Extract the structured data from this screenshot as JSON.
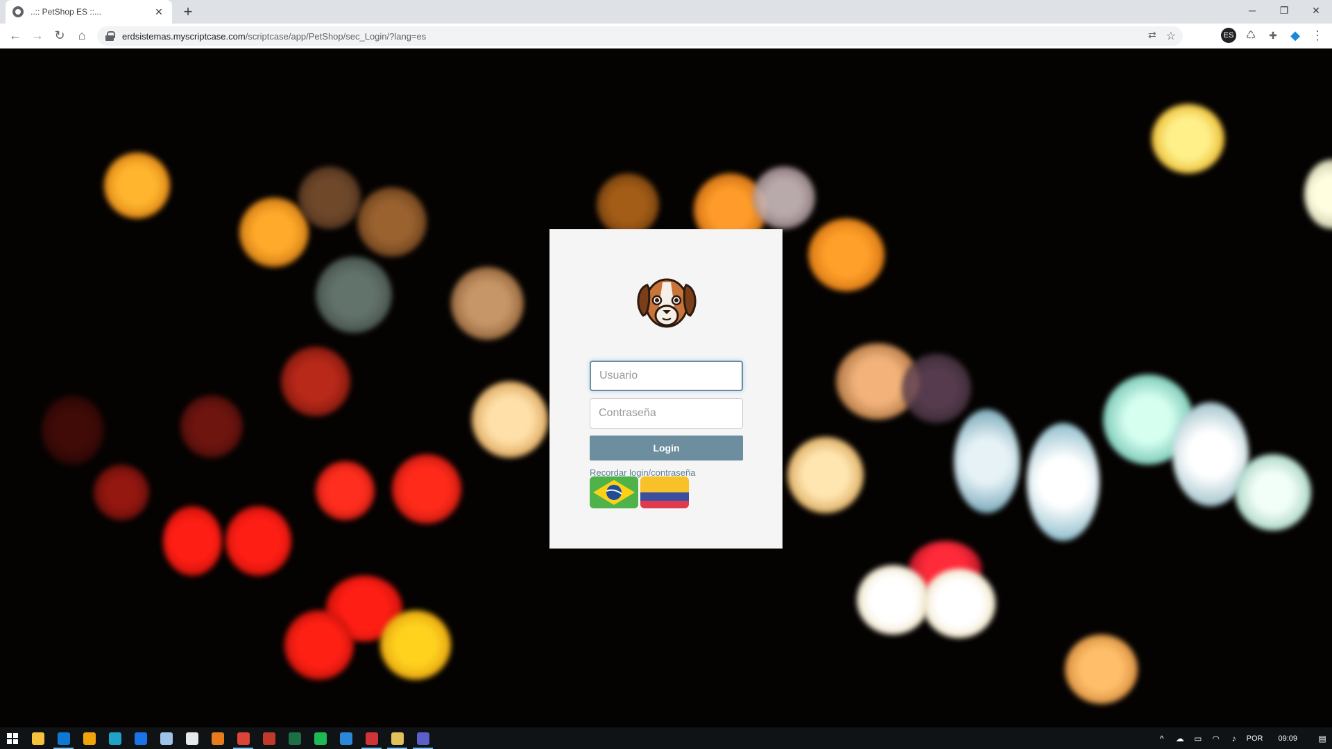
{
  "browser": {
    "tab_title": "..:: PetShop ES ::...",
    "tab_close": "✕",
    "new_tab": "+",
    "url_host": "erdsistemas.myscriptcase.com",
    "url_path": "/scriptcase/app/PetShop/sec_Login/?lang=es",
    "window_minimize": "─",
    "window_restore": "❐",
    "window_close": "✕",
    "back": "←",
    "forward": "→",
    "reload": "↻",
    "home": "⌂",
    "translate": "⇄",
    "bookmark": "☆",
    "extensions": [
      {
        "icon": "es-extension-icon",
        "label": "ES"
      },
      {
        "icon": "recycle-extension-icon",
        "label": "♺"
      },
      {
        "icon": "puzzle-extensions-icon",
        "label": "✚"
      },
      {
        "icon": "blue-extension-icon",
        "label": "◆"
      },
      {
        "icon": "menu-dots-icon",
        "label": "⋮"
      }
    ]
  },
  "login": {
    "username_placeholder": "Usuario",
    "password_placeholder": "Contraseña",
    "login_label": "Login",
    "remember_label": "Recordar login/contraseña",
    "flags": [
      "brazil-flag-icon",
      "colombia-flag-icon"
    ]
  },
  "taskbar": {
    "apps": [
      {
        "name": "file-explorer-icon",
        "color": "#f6c23e",
        "active": false
      },
      {
        "name": "outlook-icon",
        "color": "#0f78d4",
        "active": true
      },
      {
        "name": "sticky-app-icon",
        "color": "#f0a30a",
        "active": false
      },
      {
        "name": "edge-icon",
        "color": "#1fa1c8",
        "active": false
      },
      {
        "name": "mail-icon",
        "color": "#1a73e8",
        "active": false
      },
      {
        "name": "notes-icon",
        "color": "#9fc3e7",
        "active": false
      },
      {
        "name": "brave-like-icon",
        "color": "#e8e8e8",
        "active": false
      },
      {
        "name": "sublime-icon",
        "color": "#e87b1c",
        "active": false
      },
      {
        "name": "chrome-icon",
        "color": "#db4437",
        "active": true
      },
      {
        "name": "paint-icon",
        "color": "#c0392b",
        "active": false
      },
      {
        "name": "excel-icon",
        "color": "#1d7044",
        "active": false
      },
      {
        "name": "spotify-icon",
        "color": "#1db954",
        "active": false
      },
      {
        "name": "document-icon",
        "color": "#2b88d8",
        "active": false
      },
      {
        "name": "shield-app-icon",
        "color": "#d13438",
        "active": true
      },
      {
        "name": "files-icon",
        "color": "#e0c15a",
        "active": true
      },
      {
        "name": "teams-icon",
        "color": "#5b5fc7",
        "active": true
      }
    ],
    "language": "POR",
    "time": "09:09"
  }
}
